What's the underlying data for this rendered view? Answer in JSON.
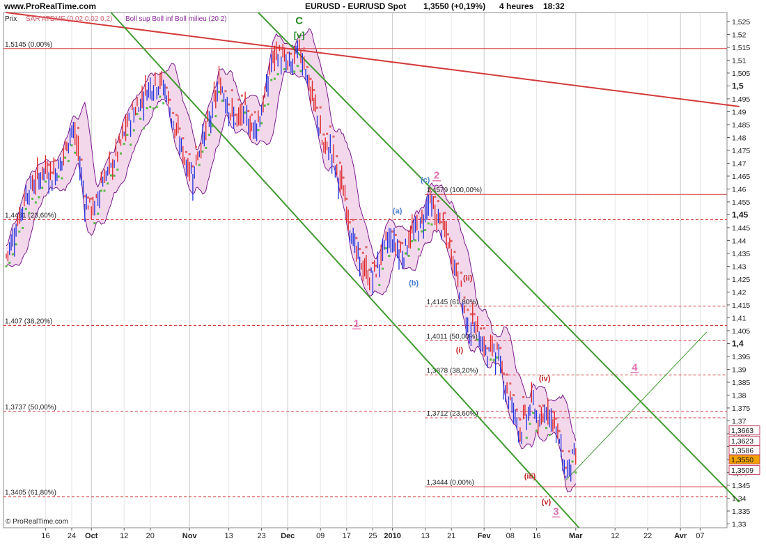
{
  "header": {
    "site": "www.ProRealTime.com",
    "instrument": "EURUSD - EUR/USD Spot",
    "price_change": "1,3550 (+0,19%)",
    "period": "4 heures",
    "time": "18:32"
  },
  "legend": {
    "prix": "Prix",
    "sar": "SAR ATDMF (0,02 0,02 0,2)",
    "boll": "Boll sup Boll inf Boll milieu (20 2)"
  },
  "copyright": "© ProRealTime.com",
  "colors": {
    "candle_up": "#2233dd",
    "candle_down": "#dd2222",
    "bollinger_fill": "#f3d8ec",
    "bollinger_line": "#7a1a8a",
    "sar_bear": "#e06060",
    "sar_bull": "#55bb44",
    "channel": "#3e9a2e",
    "downtrend": "#d43a3a",
    "fib": "#d43a3a",
    "wave_pink": "#e070b0",
    "wave_blue": "#4a7fd0",
    "wave_red": "#c02020",
    "wave_green": "#2a8a2a",
    "last_price_bg": "#f0a000"
  },
  "chart_data": {
    "type": "candlestick",
    "y_axis_side": "right",
    "ylim": [
      1.3285,
      1.5285
    ],
    "y_ticks": [
      "1,525",
      "1,52",
      "1,515",
      "1,51",
      "1,505",
      "1,5",
      "1,495",
      "1,49",
      "1,485",
      "1,48",
      "1,475",
      "1,47",
      "1,465",
      "1,46",
      "1,455",
      "1,45",
      "1,445",
      "1,44",
      "1,435",
      "1,43",
      "1,425",
      "1,42",
      "1,415",
      "1,41",
      "1,405",
      "1,4",
      "1,395",
      "1,39",
      "1,385",
      "1,38",
      "1,375",
      "1,37",
      "1,365",
      "1,36",
      "1,355",
      "1,35",
      "1,345",
      "1,34",
      "1,335",
      "1,33"
    ],
    "y_bold_ticks": [
      "1,5",
      "1,45",
      "1,4",
      "1,35"
    ],
    "x_ticks": [
      {
        "label": "16",
        "bar": 12
      },
      {
        "label": "24",
        "bar": 20
      },
      {
        "label": "Oct",
        "bar": 26,
        "bold": true
      },
      {
        "label": "12",
        "bar": 36
      },
      {
        "label": "20",
        "bar": 44
      },
      {
        "label": "Nov",
        "bar": 56,
        "bold": true
      },
      {
        "label": "13",
        "bar": 68
      },
      {
        "label": "23",
        "bar": 78
      },
      {
        "label": "Dec",
        "bar": 86,
        "bold": true
      },
      {
        "label": "09",
        "bar": 96
      },
      {
        "label": "17",
        "bar": 104
      },
      {
        "label": "25",
        "bar": 112
      },
      {
        "label": "2010",
        "bar": 118,
        "bold": true
      },
      {
        "label": "13",
        "bar": 128
      },
      {
        "label": "21",
        "bar": 136
      },
      {
        "label": "Fev",
        "bar": 146,
        "bold": true
      },
      {
        "label": "08",
        "bar": 154
      },
      {
        "label": "16",
        "bar": 162
      },
      {
        "label": "Mar",
        "bar": 174,
        "bold": true
      },
      {
        "label": "12",
        "bar": 186
      },
      {
        "label": "22",
        "bar": 196
      },
      {
        "label": "Avr",
        "bar": 206,
        "bold": true
      },
      {
        "label": "07",
        "bar": 212
      }
    ],
    "price_path": [
      [
        0,
        1.434
      ],
      [
        3,
        1.445
      ],
      [
        6,
        1.458
      ],
      [
        9,
        1.463
      ],
      [
        12,
        1.468
      ],
      [
        14,
        1.465
      ],
      [
        17,
        1.471
      ],
      [
        20,
        1.484
      ],
      [
        22,
        1.474
      ],
      [
        24,
        1.455
      ],
      [
        27,
        1.452
      ],
      [
        29,
        1.463
      ],
      [
        32,
        1.468
      ],
      [
        35,
        1.478
      ],
      [
        38,
        1.488
      ],
      [
        41,
        1.494
      ],
      [
        43,
        1.499
      ],
      [
        45,
        1.501
      ],
      [
        47,
        1.502
      ],
      [
        49,
        1.497
      ],
      [
        51,
        1.485
      ],
      [
        53,
        1.478
      ],
      [
        55,
        1.47
      ],
      [
        57,
        1.465
      ],
      [
        59,
        1.476
      ],
      [
        61,
        1.482
      ],
      [
        63,
        1.49
      ],
      [
        65,
        1.501
      ],
      [
        67,
        1.496
      ],
      [
        69,
        1.488
      ],
      [
        71,
        1.486
      ],
      [
        73,
        1.49
      ],
      [
        75,
        1.483
      ],
      [
        77,
        1.487
      ],
      [
        79,
        1.495
      ],
      [
        81,
        1.509
      ],
      [
        83,
        1.513
      ],
      [
        85,
        1.509
      ],
      [
        87,
        1.507
      ],
      [
        89,
        1.514
      ],
      [
        91,
        1.51
      ],
      [
        93,
        1.497
      ],
      [
        95,
        1.488
      ],
      [
        97,
        1.475
      ],
      [
        99,
        1.476
      ],
      [
        101,
        1.466
      ],
      [
        103,
        1.459
      ],
      [
        105,
        1.446
      ],
      [
        107,
        1.434
      ],
      [
        109,
        1.429
      ],
      [
        111,
        1.425
      ],
      [
        113,
        1.428
      ],
      [
        115,
        1.436
      ],
      [
        117,
        1.441
      ],
      [
        119,
        1.438
      ],
      [
        121,
        1.434
      ],
      [
        123,
        1.441
      ],
      [
        125,
        1.444
      ],
      [
        127,
        1.447
      ],
      [
        129,
        1.456
      ],
      [
        131,
        1.45
      ],
      [
        133,
        1.446
      ],
      [
        135,
        1.439
      ],
      [
        137,
        1.431
      ],
      [
        139,
        1.42
      ],
      [
        141,
        1.405
      ],
      [
        143,
        1.408
      ],
      [
        145,
        1.402
      ],
      [
        147,
        1.395
      ],
      [
        149,
        1.4
      ],
      [
        151,
        1.391
      ],
      [
        153,
        1.382
      ],
      [
        155,
        1.374
      ],
      [
        157,
        1.366
      ],
      [
        159,
        1.372
      ],
      [
        161,
        1.378
      ],
      [
        163,
        1.366
      ],
      [
        165,
        1.376
      ],
      [
        167,
        1.371
      ],
      [
        169,
        1.362
      ],
      [
        171,
        1.349
      ],
      [
        173,
        1.356
      ],
      [
        174,
        1.355
      ]
    ],
    "fib_levels": [
      {
        "label": "1,5145 (0,00%)",
        "value": 1.5145,
        "style": "solid",
        "side": "left"
      },
      {
        "label": "1,4481 (23,60%)",
        "value": 1.4481,
        "style": "dash",
        "side": "left"
      },
      {
        "label": "1,407 (38,20%)",
        "value": 1.407,
        "style": "dash",
        "side": "left"
      },
      {
        "label": "1,3737 (50,00%)",
        "value": 1.3737,
        "style": "dash",
        "side": "left"
      },
      {
        "label": "1,3405 (61,80%)",
        "value": 1.3405,
        "style": "dash",
        "side": "left"
      },
      {
        "label": "1,4579 (100,00%)",
        "value": 1.4579,
        "style": "solid",
        "side": "mid"
      },
      {
        "label": "1,4145 (61,80%)",
        "value": 1.4145,
        "style": "dash",
        "side": "mid"
      },
      {
        "label": "1,4011 (50,00%)",
        "value": 1.4011,
        "style": "dash",
        "side": "mid"
      },
      {
        "label": "1,3878 (38,20%)",
        "value": 1.3878,
        "style": "dash",
        "side": "mid"
      },
      {
        "label": "1,3712 (23,60%)",
        "value": 1.3712,
        "style": "dash",
        "side": "mid"
      },
      {
        "label": "1,3444 (0,00%)",
        "value": 1.3444,
        "style": "solid",
        "side": "mid"
      }
    ],
    "price_labels": [
      {
        "label": "1,3663",
        "value": 1.3663
      },
      {
        "label": "1,3623",
        "value": 1.3623
      },
      {
        "label": "1,3586",
        "value": 1.3586
      },
      {
        "label": "1,3550",
        "value": 1.355,
        "highlight": true
      },
      {
        "label": "1,3509",
        "value": 1.3509
      }
    ],
    "wave_labels": [
      {
        "text": "C",
        "bar": 89.5,
        "value": 1.524,
        "color": "wave_green",
        "size": 15
      },
      {
        "text": "[v]",
        "bar": 89.5,
        "value": 1.5185,
        "color": "wave_green",
        "size": 13
      },
      {
        "text": "1",
        "bar": 107,
        "value": 1.4065,
        "color": "wave_pink",
        "size": 15,
        "underline": true
      },
      {
        "text": "(a)",
        "bar": 119.5,
        "value": 1.4505,
        "color": "wave_blue",
        "size": 11
      },
      {
        "text": "(b)",
        "bar": 124.5,
        "value": 1.4225,
        "color": "wave_blue",
        "size": 11
      },
      {
        "text": "(c)",
        "bar": 128,
        "value": 1.4625,
        "color": "wave_blue",
        "size": 11
      },
      {
        "text": "2",
        "bar": 131.5,
        "value": 1.464,
        "color": "wave_pink",
        "size": 15,
        "underline": true
      },
      {
        "text": "(ii)",
        "bar": 141,
        "value": 1.4245,
        "color": "wave_red",
        "size": 11
      },
      {
        "text": "(i)",
        "bar": 138.5,
        "value": 1.3965,
        "color": "wave_red",
        "size": 11
      },
      {
        "text": "(iv)",
        "bar": 164.5,
        "value": 1.3855,
        "color": "wave_red",
        "size": 11
      },
      {
        "text": "(iii)",
        "bar": 160,
        "value": 1.3475,
        "color": "wave_red",
        "size": 11
      },
      {
        "text": "(v)",
        "bar": 165,
        "value": 1.3375,
        "color": "wave_red",
        "size": 11
      },
      {
        "text": "3",
        "bar": 168,
        "value": 1.3335,
        "color": "wave_pink",
        "size": 15,
        "underline": true
      },
      {
        "text": "4",
        "bar": 192,
        "value": 1.3895,
        "color": "wave_pink",
        "size": 15,
        "underline": true
      }
    ],
    "trendlines": [
      {
        "name": "long-downtrend",
        "color": "downtrend",
        "width": 2,
        "from": [
          0,
          1.5285
        ],
        "to": [
          224,
          1.492
        ]
      },
      {
        "name": "channel-upper",
        "color": "channel",
        "width": 2,
        "from": [
          77,
          1.5285
        ],
        "to": [
          224,
          1.3385
        ]
      },
      {
        "name": "channel-lower",
        "color": "channel",
        "width": 2,
        "from": [
          32,
          1.5285
        ],
        "to": [
          175,
          1.3285
        ]
      },
      {
        "name": "target-line",
        "color": "channel",
        "width": 1,
        "from": [
          171,
          1.347
        ],
        "to": [
          214,
          1.4045
        ]
      }
    ]
  }
}
